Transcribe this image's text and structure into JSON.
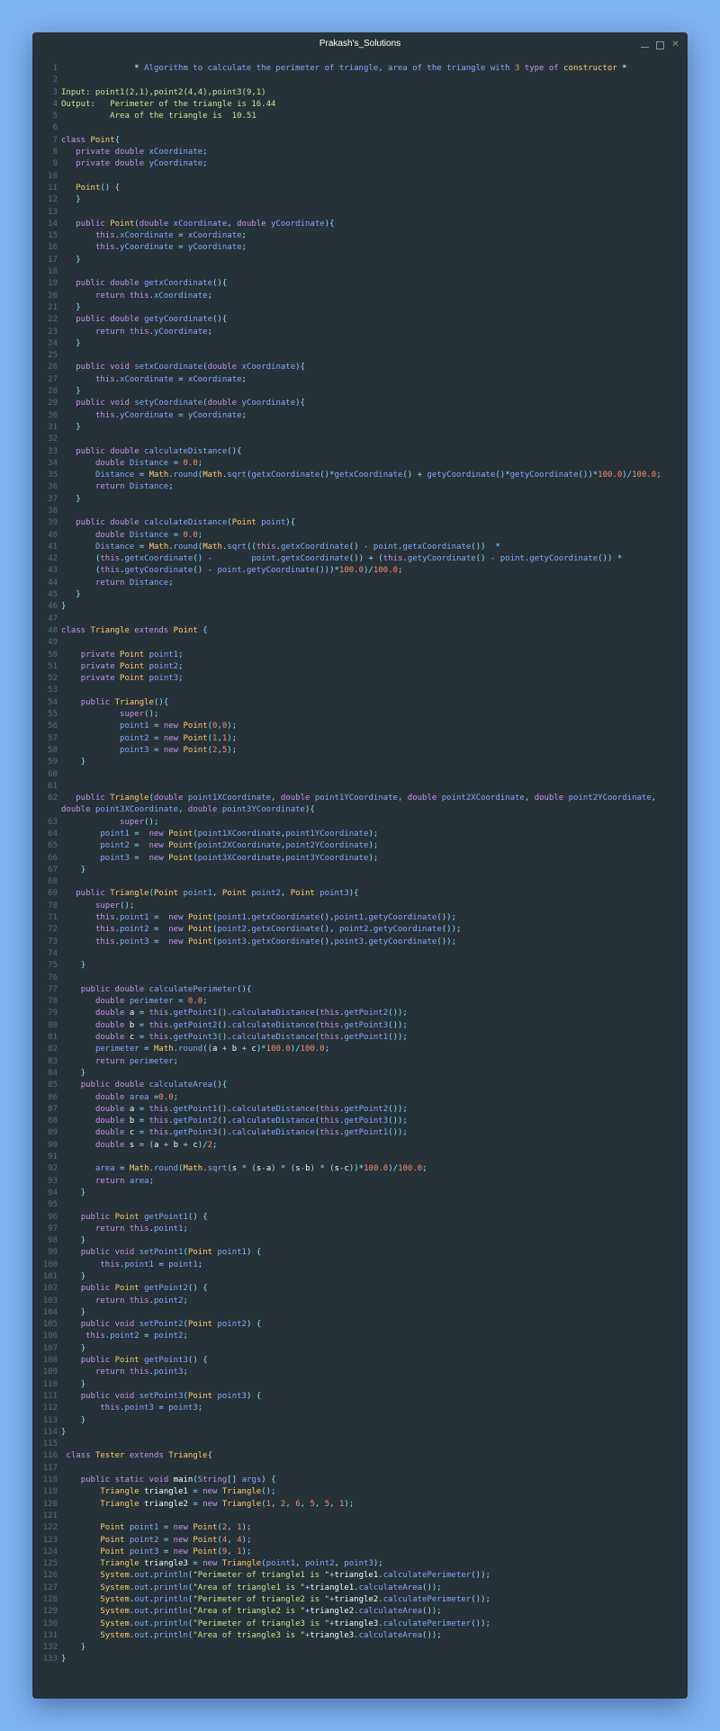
{
  "window": {
    "title": "Prakash's_Solutions"
  },
  "icons": {
    "minimize": "minimize-icon",
    "maximize": "maximize-icon",
    "close": "close-icon"
  },
  "code_lines": [
    "               * Algorithm to calculate the perimeter of triangle, area of the triangle with 3 type of constructor *",
    "",
    "Input: point1(2,1),point2(4,4),point3(9,1)",
    "Output:   Perimeter of the triangle is 16.44",
    "          Area of the triangle is  10.51",
    "",
    "class Point{",
    "   private double xCoordinate;",
    "   private double yCoordinate;",
    "",
    "   Point() {",
    "   }",
    "",
    "   public Point(double xCoordinate, double yCoordinate){",
    "       this.xCoordinate = xCoordinate;",
    "       this.yCoordinate = yCoordinate;",
    "   }",
    "",
    "   public double getxCoordinate(){",
    "       return this.xCoordinate;",
    "   }",
    "   public double getyCoordinate(){",
    "       return this.yCoordinate;",
    "   }",
    "",
    "   public void setxCoordinate(double xCoordinate){",
    "       this.xCoordinate = xCoordinate;",
    "   }",
    "   public void setyCoordinate(double yCoordinate){",
    "       this.yCoordinate = yCoordinate;",
    "   }",
    "",
    "   public double calculateDistance(){",
    "       double Distance = 0.0;",
    "       Distance = Math.round(Math.sqrt(getxCoordinate()*getxCoordinate() + getyCoordinate()*getyCoordinate())*100.0)/100.0;",
    "       return Distance;",
    "   }",
    "",
    "   public double calculateDistance(Point point){",
    "       double Distance = 0.0;",
    "       Distance = Math.round(Math.sqrt((this.getxCoordinate() - point.getxCoordinate())  *",
    "       (this.getxCoordinate() -        point.getxCoordinate()) + (this.getyCoordinate() - point.getyCoordinate()) *",
    "       (this.getyCoordinate() - point.getyCoordinate()))*100.0)/100.0;",
    "       return Distance;",
    "   }",
    "}",
    "",
    "class Triangle extends Point {",
    "",
    "    private Point point1;",
    "    private Point point2;",
    "    private Point point3;",
    "",
    "    public Triangle(){",
    "            super();",
    "            point1 = new Point(0,0);",
    "            point2 = new Point(1,1);",
    "            point3 = new Point(2,5);",
    "    }",
    "",
    "",
    "   public Triangle(double point1XCoordinate, double point1YCoordinate, double point2XCoordinate, double point2YCoordinate,\ndouble point3XCoordinate, double point3YCoordinate){",
    "            super();",
    "        point1 =  new Point(point1XCoordinate,point1YCoordinate);",
    "        point2 =  new Point(point2XCoordinate,point2YCoordinate);",
    "        point3 =  new Point(point3XCoordinate,point3YCoordinate);",
    "    }",
    "",
    "   public Triangle(Point point1, Point point2, Point point3){",
    "       super();",
    "       this.point1 =  new Point(point1.getxCoordinate(),point1.getyCoordinate());",
    "       this.point2 =  new Point(point2.getxCoordinate(), point2.getyCoordinate());",
    "       this.point3 =  new Point(point3.getxCoordinate(),point3.getyCoordinate());",
    "",
    "    }",
    "",
    "    public double calculatePerimeter(){",
    "       double perimeter = 0.0;",
    "       double a = this.getPoint1().calculateDistance(this.getPoint2());",
    "       double b = this.getPoint2().calculateDistance(this.getPoint3());",
    "       double c = this.getPoint3().calculateDistance(this.getPoint1());",
    "       perimeter = Math.round((a + b + c)*100.0)/100.0;",
    "       return perimeter;",
    "    }",
    "    public double calculateArea(){",
    "       double area =0.0;",
    "       double a = this.getPoint1().calculateDistance(this.getPoint2());",
    "       double b = this.getPoint2().calculateDistance(this.getPoint3());",
    "       double c = this.getPoint3().calculateDistance(this.getPoint1());",
    "       double s = (a + b + c)/2;",
    "",
    "       area = Math.round(Math.sqrt(s * (s-a) * (s-b) * (s-c))*100.0)/100.0;",
    "       return area;",
    "    }",
    "",
    "    public Point getPoint1() {",
    "       return this.point1;",
    "    }",
    "    public void setPoint1(Point point1) {",
    "        this.point1 = point1;",
    "    }",
    "    public Point getPoint2() {",
    "       return this.point2;",
    "    }",
    "    public void setPoint2(Point point2) {",
    "     this.point2 = point2;",
    "    }",
    "    public Point getPoint3() {",
    "       return this.point3;",
    "    }",
    "    public void setPoint3(Point point3) {",
    "        this.point3 = point3;",
    "    }",
    "}",
    "",
    " class Tester extends Triangle{",
    "",
    "    public static void main(String[] args) {",
    "        Triangle triangle1 = new Triangle();",
    "        Triangle triangle2 = new Triangle(1, 2, 6, 5, 5, 1);",
    "",
    "        Point point1 = new Point(2, 1);",
    "        Point point2 = new Point(4, 4);",
    "        Point point3 = new Point(9, 1);",
    "        Triangle triangle3 = new Triangle(point1, point2, point3);",
    "        System.out.println(\"Perimeter of triangle1 is \"+triangle1.calculatePerimeter());",
    "        System.out.println(\"Area of triangle1 is \"+triangle1.calculateArea());",
    "        System.out.println(\"Perimeter of triangle2 is \"+triangle2.calculatePerimeter());",
    "        System.out.println(\"Area of triangle2 is \"+triangle2.calculateArea());",
    "        System.out.println(\"Perimeter of triangle3 is \"+triangle3.calculatePerimeter());",
    "        System.out.println(\"Area of triangle3 is \"+triangle3.calculateArea());",
    "    }",
    "}"
  ]
}
